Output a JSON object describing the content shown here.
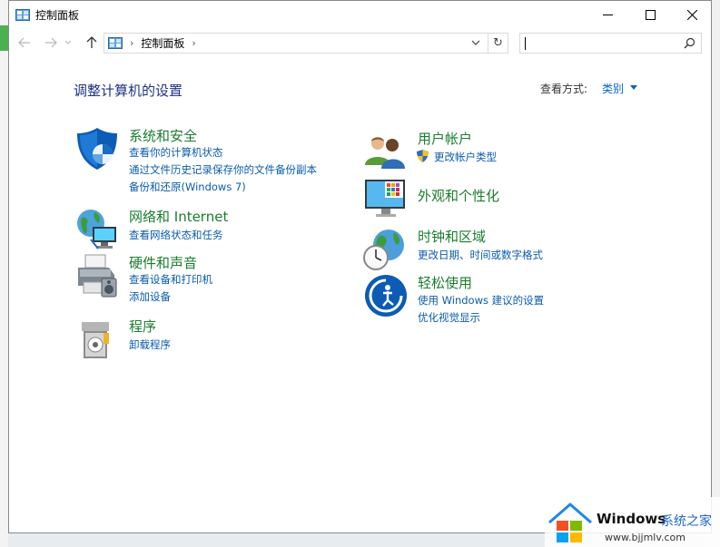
{
  "window": {
    "title": "控制面板"
  },
  "nav": {
    "breadcrumb": "控制面板",
    "search_placeholder": ""
  },
  "content": {
    "heading": "调整计算机的设置",
    "view_by_label": "查看方式:",
    "view_by_value": "类别"
  },
  "categories": {
    "system": {
      "title": "系统和安全",
      "links": [
        "查看你的计算机状态",
        "通过文件历史记录保存你的文件备份副本",
        "备份和还原(Windows 7)"
      ]
    },
    "network": {
      "title": "网络和 Internet",
      "links": [
        "查看网络状态和任务"
      ]
    },
    "hardware": {
      "title": "硬件和声音",
      "links": [
        "查看设备和打印机",
        "添加设备"
      ]
    },
    "programs": {
      "title": "程序",
      "links": [
        "卸载程序"
      ]
    },
    "user": {
      "title": "用户帐户",
      "links": [
        "更改帐户类型"
      ]
    },
    "appearance": {
      "title": "外观和个性化",
      "links": []
    },
    "clock": {
      "title": "时钟和区域",
      "links": [
        "更改日期、时间或数字格式"
      ]
    },
    "ease": {
      "title": "轻松使用",
      "links": [
        "使用 Windows 建议的设置",
        "优化视觉显示"
      ]
    }
  },
  "watermark": {
    "name": "Windows",
    "cn": "系统之家",
    "url": "www.bjjmlv.com"
  },
  "colors": {
    "heading": "#1e3287",
    "category_title": "#1a7d2c",
    "link": "#0b5cad"
  }
}
